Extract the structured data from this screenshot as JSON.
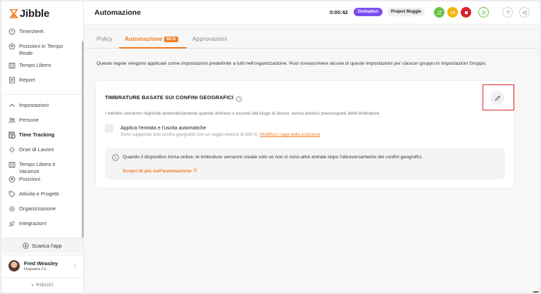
{
  "app": {
    "logo_text": "Jibble",
    "brand_color": "#f07c23"
  },
  "sidebar": {
    "items_top": [
      {
        "label": "Timesheet",
        "icon": "clock-icon"
      },
      {
        "label": "Posizioni in Tempo Reale",
        "icon": "location-pin-icon"
      },
      {
        "label": "Tempo Libero",
        "icon": "calendar-icon"
      },
      {
        "label": "Report",
        "icon": "report-icon"
      }
    ],
    "settings_label": "Impostazioni",
    "items_settings": [
      {
        "label": "Persone",
        "icon": "people-icon"
      },
      {
        "label": "Time Tracking",
        "icon": "time-tracking-icon",
        "active": true
      },
      {
        "label": "Orari di Lavoro",
        "icon": "schedule-icon"
      },
      {
        "label": "Tempo Libero e Vacanze",
        "icon": "holiday-icon"
      },
      {
        "label": "Posizioni",
        "icon": "location-pin-icon"
      },
      {
        "label": "Attività e Progetti",
        "icon": "tag-icon"
      },
      {
        "label": "Organizzazione",
        "icon": "gear-icon"
      },
      {
        "label": "Integrazioni",
        "icon": "plug-icon"
      }
    ],
    "download_label": "Scarica l'app",
    "user": {
      "name": "Fred Weasley",
      "org": "Hogwarts Co"
    },
    "collapse_label": "RIDUCI"
  },
  "header": {
    "title": "Automazione",
    "timer": "0:00:42",
    "org_pill": "Divination",
    "project_pill": "Project Muggle"
  },
  "tabs": [
    {
      "label": "Policy"
    },
    {
      "label": "Automazione",
      "badge": "BETA",
      "active": true
    },
    {
      "label": "Approvazioni"
    }
  ],
  "intro": "Queste regole vengono applicate come impostazioni predefinite a tutti nell'organizzazione. Puoi sovrascrivere alcune di queste impostazioni per ciascun gruppo in Impostazioni Gruppo.",
  "card": {
    "title": "TIMBRATURE BASATE SUI CONFINI GEOGRAFICI",
    "description": "I membri verranno registrati automaticamente quando entrano o escono dal luogo di lavoro, senza doversi preoccupare delle timbrature.",
    "checkbox_label": "Applica l'entrata e l'uscita automatiche",
    "checkbox_checked": false,
    "help_text": "Sono supportati solo confini geografici con un raggio minimo di 300 m.",
    "help_link": "Modifica i raggi della posizione",
    "info_text": "Quando il dispositivo torna online, le timbrature verranno create solo se non ci sono altre entrate dopo l'attraversamento dei confini geografici.",
    "info_link": "Scopri di più sull'automazione"
  }
}
